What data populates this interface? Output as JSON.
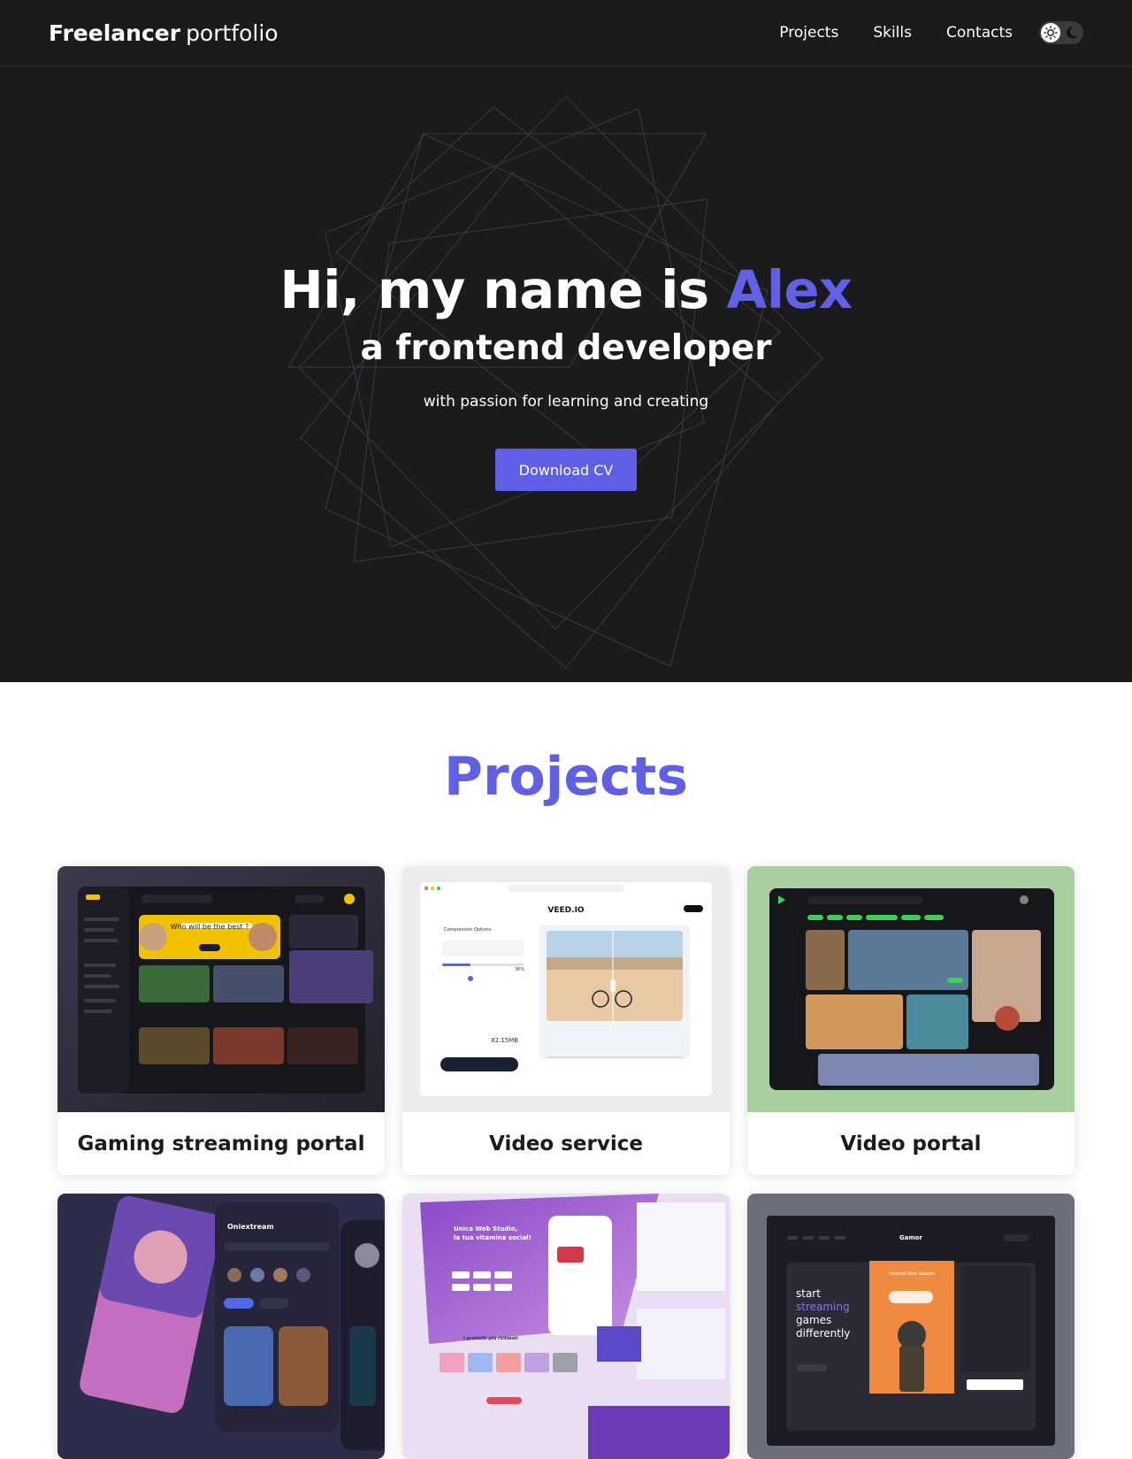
{
  "header": {
    "brand_strong": "Freelancer",
    "brand_light": "portfolio",
    "nav": [
      {
        "label": "Projects"
      },
      {
        "label": "Skills"
      },
      {
        "label": "Contacts"
      }
    ],
    "theme_toggle": {
      "light_icon": "sun-icon",
      "dark_icon": "moon-icon"
    }
  },
  "hero": {
    "title_prefix": "Hi, my name is",
    "name": "Alex",
    "subtitle": "a frontend developer",
    "tagline": "with passion for learning and creating",
    "button_label": "Download CV"
  },
  "projects": {
    "title": "Projects",
    "items": [
      {
        "label": "Gaming streaming portal"
      },
      {
        "label": "Video service"
      },
      {
        "label": "Video portal"
      },
      {
        "label": ""
      },
      {
        "label": ""
      },
      {
        "label": ""
      }
    ]
  },
  "thumbnails": {
    "veed_logo": "VEED.IO",
    "veed_panel_title": "Compression Options",
    "veed_size": "82.15MB",
    "veed_percent": "36%",
    "gaming_banner": "Who will be the best ?",
    "oniex_title": "Oniextream",
    "unica_title": "Unica Web Studio,",
    "unica_sub": "la tua vitamina social!",
    "unica_products": "I prodotti più richiesti",
    "gamor_logo": "Gamor",
    "gamor_headline_1": "start",
    "gamor_headline_2": "streaming",
    "gamor_headline_3": "games",
    "gamor_headline_4": "differently",
    "gamor_banner": "Fortnite New Season"
  },
  "colors": {
    "accent": "#5e5ee6",
    "dark_bg": "#1b1a1c"
  }
}
